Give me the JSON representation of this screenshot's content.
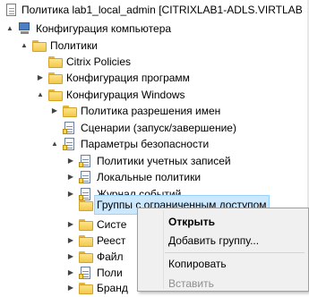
{
  "tree": {
    "root": "Политика lab1_local_admin [CITRIXLAB1-ADLS.VIRTLAB",
    "computer_config": "Конфигурация компьютера",
    "policies": "Политики",
    "citrix_policies": "Citrix Policies",
    "software_config": "Конфигурация программ",
    "windows_config": "Конфигурация Windows",
    "name_resolution": "Политика разрешения имен",
    "scripts": "Сценарии (запуск/завершение)",
    "security_settings": "Параметры безопасности",
    "account_policies": "Политики учетных записей",
    "local_policies": "Локальные политики",
    "event_log": "Журнал событий",
    "restricted_groups": "Группы с ограниченным доступом",
    "system_services": "Систе",
    "registry": "Реест",
    "file_system": "Файл",
    "network_policies": "Поли",
    "firewall": "Бранд"
  },
  "icons": {
    "toggle_expanded": "▲",
    "toggle_collapsed": "▶"
  },
  "context_menu": {
    "open": "Открыть",
    "add_group": "Добавить группу...",
    "copy": "Копировать",
    "paste": "Вставить"
  },
  "colors": {
    "selection_bg": "#cce8ff",
    "menu_bg": "#f0f0f0"
  }
}
